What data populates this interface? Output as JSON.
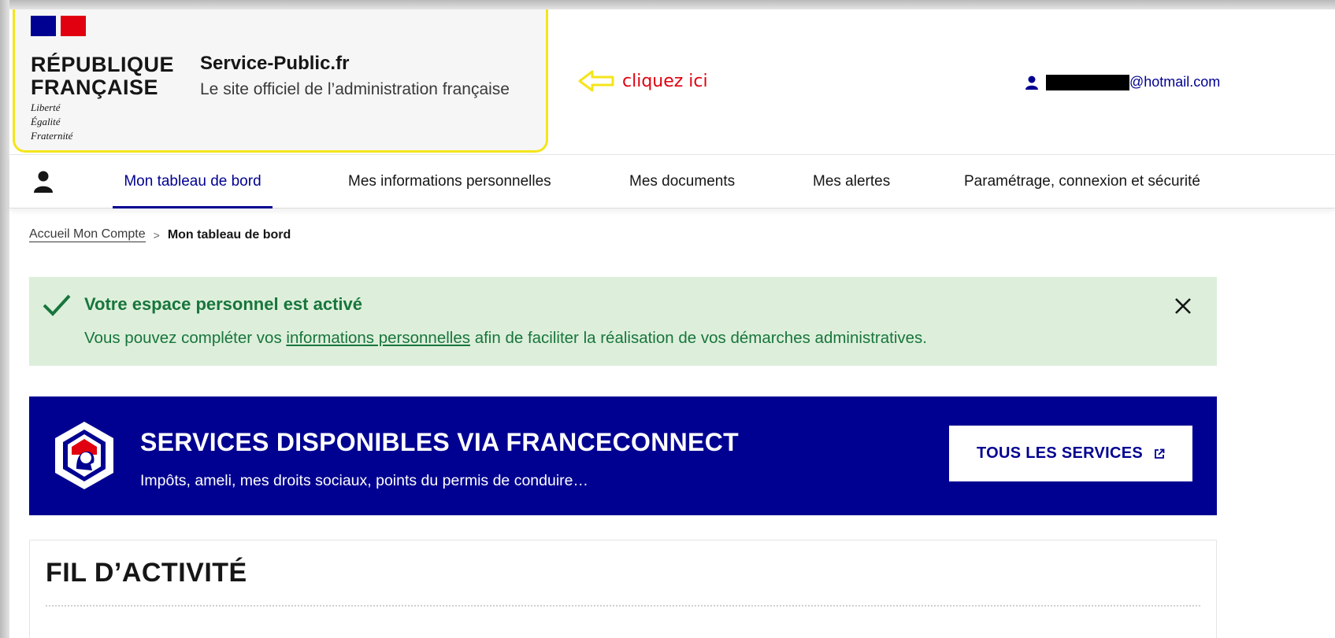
{
  "header": {
    "republic_line1": "RÉPUBLIQUE",
    "republic_line2": "FRANÇAISE",
    "motto": [
      "Liberté",
      "Égalité",
      "Fraternité"
    ],
    "site_name": "Service-Public.fr",
    "site_tagline": "Le site officiel de l’administration française",
    "annotation_text": "cliquez ici",
    "user_email_visible": "@hotmail.com",
    "user_icon": "user-icon"
  },
  "nav": {
    "items": [
      {
        "label": "Mon tableau de bord",
        "active": true
      },
      {
        "label": "Mes informations personnelles",
        "active": false
      },
      {
        "label": "Mes documents",
        "active": false
      },
      {
        "label": "Mes alertes",
        "active": false
      },
      {
        "label": "Paramétrage, connexion et sécurité",
        "active": false
      }
    ]
  },
  "breadcrumb": {
    "parent": "Accueil Mon Compte",
    "separator": ">",
    "current": "Mon tableau de bord"
  },
  "alert": {
    "title": "Votre espace personnel est activé",
    "text_before": "Vous pouvez compléter vos ",
    "link": "informations personnelles",
    "text_after": " afin de faciliter la réalisation de vos démarches administratives."
  },
  "banner": {
    "title": "SERVICES DISPONIBLES VIA FRANCECONNECT",
    "subtitle": "Impôts, ameli, mes droits sociaux, points du permis de conduire…",
    "button_label": "TOUS LES SERVICES"
  },
  "activity": {
    "title": "FIL D’ACTIVITÉ"
  },
  "colors": {
    "primary_blue": "#000091",
    "marianne_red": "#e1000f",
    "success_green": "#18753c",
    "success_bg": "#ddefdb",
    "highlight_yellow": "#f5e51a"
  }
}
